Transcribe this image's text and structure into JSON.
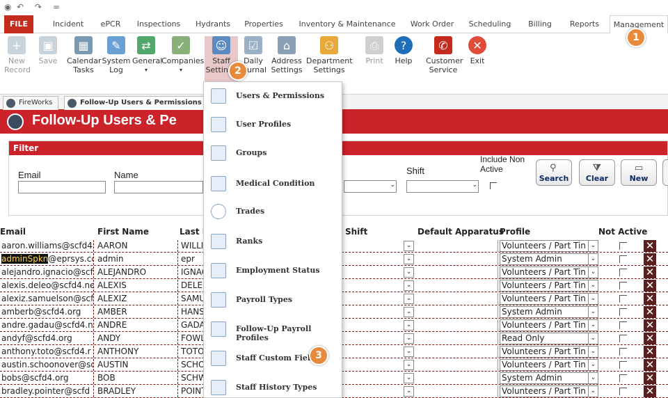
{
  "tabs": [
    "FILE",
    "Incident",
    "ePCR",
    "Inspections",
    "Hydrants",
    "Properties",
    "Inventory & Maintenance",
    "Work Order",
    "Scheduling",
    "Billing",
    "Reports",
    "Management"
  ],
  "ribbon": {
    "new_record": "New Record",
    "save": "Save",
    "calendar_tasks": "Calendar Tasks",
    "system_log": "System Log",
    "general": "General",
    "companies": "Companies",
    "staff_settings": "Staff Settings",
    "daily_journal": "Daily Journal",
    "address_settings": "Address Settings",
    "department_settings": "Department Settings",
    "print": "Print",
    "help": "Help",
    "customer_service": "Customer Service",
    "exit": "Exit"
  },
  "doc_tabs": [
    "FireWorks",
    "Follow-Up Users & Permissions"
  ],
  "page_title": "Follow-Up Users & Pe",
  "filter": {
    "title": "Filter",
    "email_label": "Email",
    "name_label": "Name",
    "shift_label": "Shift",
    "include_non_active": "Include Non Active",
    "search": "Search",
    "clear": "Clear",
    "new": "New"
  },
  "grid": {
    "headers": {
      "email": "Email",
      "first": "First Name",
      "last": "Last N",
      "shift": "Shift",
      "apparatus": "Default Apparatus",
      "profile": "Profile",
      "not_active": "Not Active"
    },
    "rows": [
      {
        "email": "aaron.williams@scfd4",
        "first": "AARON",
        "last": "WILLI",
        "profile": "Volunteers / Part Tin"
      },
      {
        "email": "adminSpkn@eprsys.cc",
        "first": "admin",
        "last": "epr",
        "profile": "System Admin"
      },
      {
        "email": "alejandro.ignacio@scf",
        "first": "ALEJANDRO",
        "last": "IGNAC",
        "profile": "Volunteers / Part Tin"
      },
      {
        "email": "alexis.deleo@scfd4.ne",
        "first": "ALEXIS",
        "last": "DELEC",
        "profile": "Volunteers / Part Tin"
      },
      {
        "email": "alexiz.samuelson@scf",
        "first": "ALEXIZ",
        "last": "SAMU",
        "profile": "Volunteers / Part Tin"
      },
      {
        "email": "amberb@scfd4.org",
        "first": "AMBER",
        "last": "HANS",
        "profile": "System Admin"
      },
      {
        "email": "andre.gadau@scfd4.n",
        "first": "ANDRE",
        "last": "GADA",
        "profile": "Volunteers / Part Tin"
      },
      {
        "email": "andyf@scfd4.org",
        "first": "ANDY",
        "last": "FOWL",
        "profile": "Read Only"
      },
      {
        "email": "anthony.toto@scfd4.r",
        "first": "ANTHONY",
        "last": "TOTO",
        "profile": "Volunteers / Part Tin"
      },
      {
        "email": "austin.schoonover@sc",
        "first": "AUSTIN",
        "last": "SCHO",
        "profile": "Volunteers / Part Tin"
      },
      {
        "email": "bobs@scfd4.org",
        "first": "BOB",
        "last": "SCHW",
        "profile": "System Admin"
      },
      {
        "email": "bradley.pointer@scfd",
        "first": "BRADLEY",
        "last": "POINT",
        "profile": "Volunteers / Part Tin"
      }
    ]
  },
  "menu": [
    "Users & Permissions",
    "User Profiles",
    "Groups",
    "Medical Condition",
    "Trades",
    "Ranks",
    "Employment Status",
    "Payroll Types",
    "Follow-Up Payroll Profiles",
    "Staff Custom Fields",
    "Staff History Types"
  ],
  "badges": [
    "1",
    "2",
    "3"
  ]
}
